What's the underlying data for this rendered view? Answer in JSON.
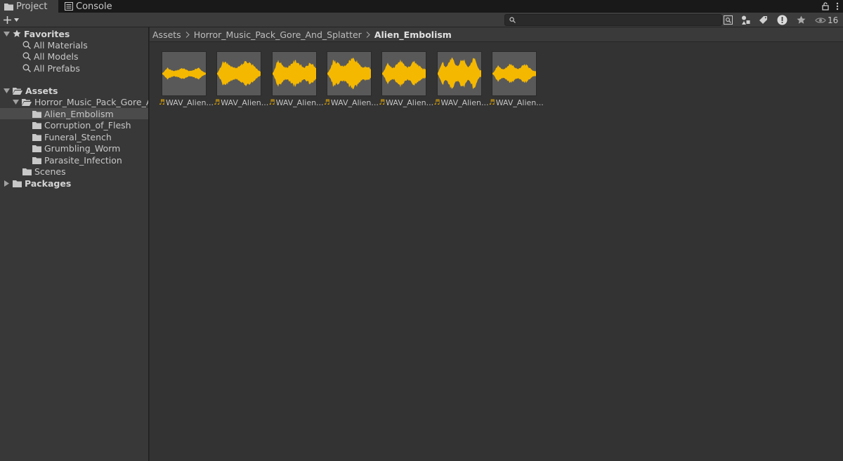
{
  "tabs": [
    {
      "label": "Project",
      "icon": "folder-icon"
    },
    {
      "label": "Console",
      "icon": "console-icon"
    }
  ],
  "toolbar": {
    "create_label": "+",
    "search_placeholder": "",
    "visible_count": "16"
  },
  "tree": {
    "favorites_label": "Favorites",
    "favorites": [
      "All Materials",
      "All Models",
      "All Prefabs"
    ],
    "assets_label": "Assets",
    "pack_label": "Horror_Music_Pack_Gore_Ar",
    "subfolders": [
      "Alien_Embolism",
      "Corruption_of_Flesh",
      "Funeral_Stench",
      "Grumbling_Worm",
      "Parasite_Infection"
    ],
    "selected_folder": "Alien_Embolism",
    "scenes_label": "Scenes",
    "packages_label": "Packages"
  },
  "breadcrumb": {
    "items": [
      "Assets",
      "Horror_Music_Pack_Gore_And_Splatter"
    ],
    "current": "Alien_Embolism"
  },
  "assets": [
    {
      "label": "WAV_Alien..."
    },
    {
      "label": "WAV_Alien..."
    },
    {
      "label": "WAV_Alien..."
    },
    {
      "label": "WAV_Alien..."
    },
    {
      "label": "WAV_Alien..."
    },
    {
      "label": "WAV_Alien..."
    },
    {
      "label": "WAV_Alien..."
    }
  ],
  "colors": {
    "waveform": "#f5b800",
    "panel_bg": "#383838",
    "main_bg": "#333333"
  }
}
